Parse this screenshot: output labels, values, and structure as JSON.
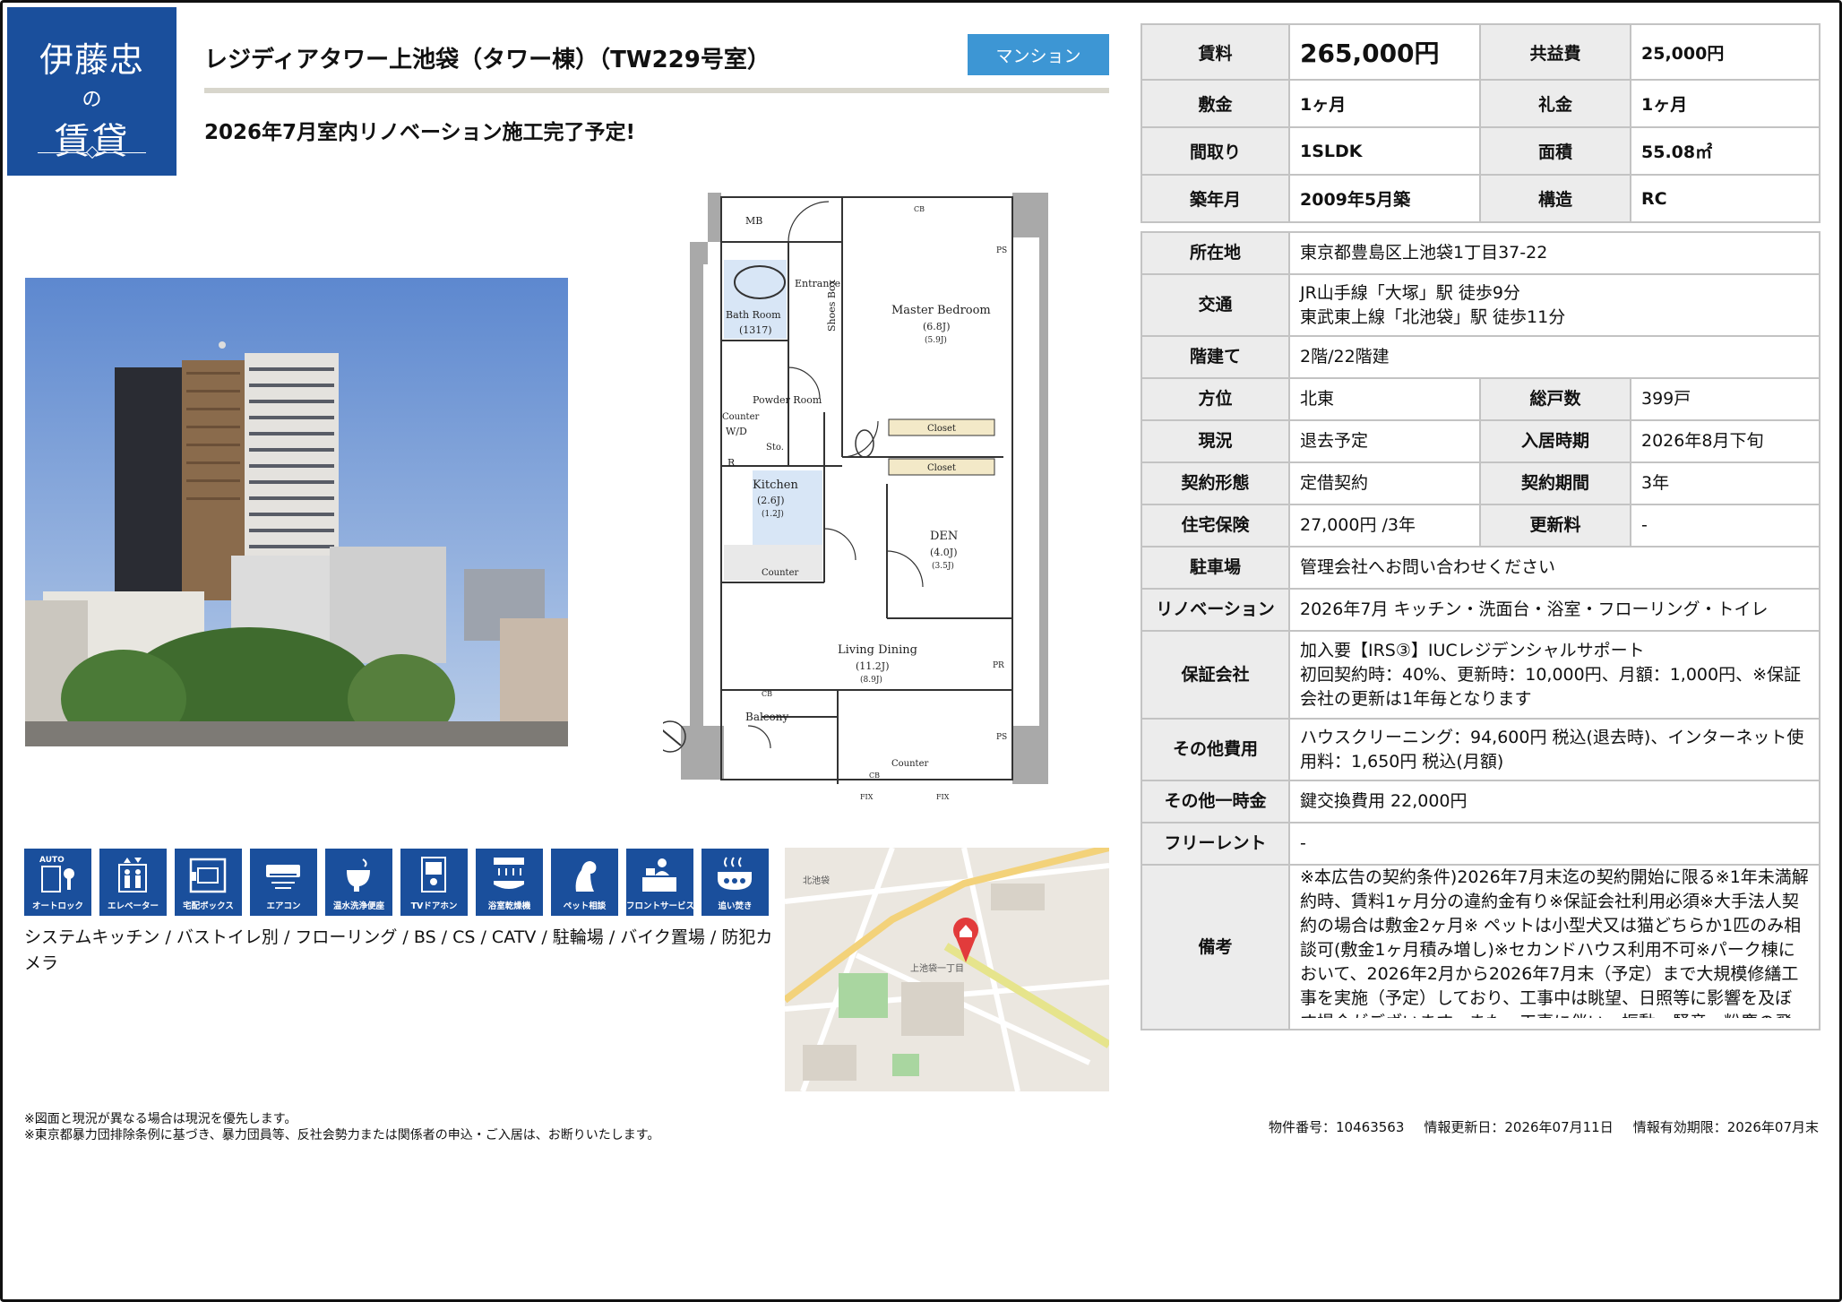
{
  "logo": {
    "line1": "伊藤忠",
    "line2": "の",
    "line3": "賃貸"
  },
  "header": {
    "title": "レジディアタワー上池袋（タワー棟）（TW229号室）",
    "type_badge": "マンション",
    "catch_copy": "2026年7月室内リノベーション施工完了予定!"
  },
  "colors": {
    "brand": "#1a4f9c",
    "badge": "#3d96d4",
    "label_bg": "#ececec"
  },
  "floorplan": {
    "rooms": [
      "MB",
      "Entrance",
      "Shoes Box",
      "Master Bedroom",
      "(6.8J)",
      "(5.9J)",
      "Bath Room",
      "(1317)",
      "Powder Room",
      "Counter",
      "W/D",
      "Sto.",
      "R",
      "Kitchen",
      "(2.6J)",
      "(1.2J)",
      "Closet",
      "Closet",
      "DEN",
      "(4.0J)",
      "(3.5J)",
      "Counter",
      "Living Dining",
      "(11.2J)",
      "(8.9J)",
      "PR",
      "PS",
      "PS",
      "CB",
      "CB",
      "CB",
      "Balcony",
      "Counter",
      "FIX",
      "FIX"
    ]
  },
  "amenities": [
    {
      "icon": "auto-lock-icon",
      "label": "オートロック"
    },
    {
      "icon": "elevator-icon",
      "label": "エレベーター"
    },
    {
      "icon": "delivery-box-icon",
      "label": "宅配ボックス"
    },
    {
      "icon": "air-conditioner-icon",
      "label": "エアコン"
    },
    {
      "icon": "washlet-toilet-icon",
      "label": "温水洗浄便座"
    },
    {
      "icon": "tv-intercom-icon",
      "label": "TVドアホン"
    },
    {
      "icon": "bathroom-dryer-icon",
      "label": "浴室乾燥機"
    },
    {
      "icon": "pet-icon",
      "label": "ペット相談"
    },
    {
      "icon": "front-service-icon",
      "label": "フロントサービス"
    },
    {
      "icon": "reheating-bath-icon",
      "label": "追い焚き"
    }
  ],
  "equipment_text": "システムキッチン / バストイレ別 / フローリング / BS / CS / CATV / 駐輪場 / バイク置場 / 防犯カメラ",
  "map": {
    "labels": [
      "上池袋一丁目",
      "北池袋"
    ]
  },
  "notes": [
    "※図面と現況が異なる場合は現況を優先します。",
    "※東京都暴力団排除条例に基づき、暴力団員等、反社会勢力または関係者の申込・ご入居は、お断りいたします。"
  ],
  "meta": {
    "property_no": "物件番号：10463563",
    "updated": "情報更新日：2026年07月11日",
    "valid_until": "情報有効期限：2026年07月末"
  },
  "summary": {
    "rent_label": "賃料",
    "rent": "265,000円",
    "common_fee_label": "共益費",
    "common_fee": "25,000円",
    "deposit_label": "敷金",
    "deposit": "1ヶ月",
    "key_money_label": "礼金",
    "key_money": "1ヶ月",
    "layout_label": "間取り",
    "layout": "1SLDK",
    "area_label": "面積",
    "area": "55.08㎡",
    "built_label": "築年月",
    "built": "2009年5月築",
    "structure_label": "構造",
    "structure": "RC"
  },
  "details": {
    "address_label": "所在地",
    "address": "東京都豊島区上池袋1丁目37-22",
    "access_label": "交通",
    "access_1": "JR山手線「大塚」駅 徒歩9分",
    "access_2": "東武東上線「北池袋」駅 徒歩11分",
    "floors_label": "階建て",
    "floors": "2階/22階建",
    "direction_label": "方位",
    "direction": "北東",
    "units_label": "総戸数",
    "units": "399戸",
    "status_label": "現況",
    "status": "退去予定",
    "move_in_label": "入居時期",
    "move_in": "2026年8月下旬",
    "contract_type_label": "契約形態",
    "contract_type": "定借契約",
    "contract_term_label": "契約期間",
    "contract_term": "3年",
    "insurance_label": "住宅保険",
    "insurance": "27,000円 /3年",
    "renewal_label": "更新料",
    "renewal": "-",
    "parking_label": "駐車場",
    "parking": "管理会社へお問い合わせください",
    "renovation_label": "リノベーション",
    "renovation": "2026年7月 キッチン・洗面台・浴室・フローリング・トイレ",
    "guarantor_label": "保証会社",
    "guarantor_1": "加入要【IRS③】IUCレジデンシャルサポート",
    "guarantor_2": "初回契約時：40%、更新時：10,000円、月額：1,000円、※保証会社の更新は1年毎となります",
    "other_fees_label": "その他費用",
    "other_fees": "ハウスクリーニング：94,600円 税込(退去時)、インターネット使用料：1,650円 税込(月額)",
    "one_time_label": "その他一時金",
    "one_time": "鍵交換費用 22,000円",
    "free_rent_label": "フリーレント",
    "free_rent": "-",
    "remarks_label": "備考",
    "remarks": "※本広告の契約条件)2026年7月末迄の契約開始に限る※1年未満解約時、賃料1ヶ月分の違約金有り※保証会社利用必須※大手法人契約の場合は敷金2ヶ月※ ペットは小型犬又は猫どちらか1匹のみ相談可(敷金1ヶ月積み増し)※セカンドハウス利用不可※パーク棟において、2026年2月から2026年7月末（予定）まで大規模修繕工事を実施（予定）しており、工事中は眺望、日照等に影響を及ぼす場合がございます。また、工事に伴い、振動、騒音、粉塵の飛散、臭"
  }
}
